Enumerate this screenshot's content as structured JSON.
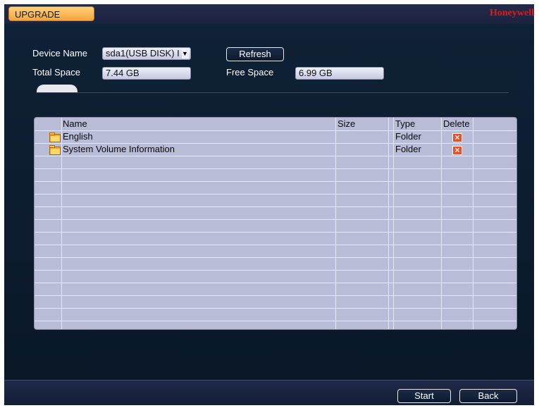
{
  "window": {
    "title": "UPGRADE",
    "brand": "Honeywell"
  },
  "device": {
    "name_label": "Device Name",
    "name_value": "sda1(USB DISK) I",
    "refresh_label": "Refresh",
    "total_label": "Total Space",
    "total_value": "7.44 GB",
    "free_label": "Free Space",
    "free_value": "6.99 GB"
  },
  "table": {
    "headers": [
      "Name",
      "Size",
      "Type",
      "Delete"
    ],
    "rows": [
      {
        "name": "English",
        "size": "",
        "type": "Folder",
        "icon": "folder-icon",
        "delete_icon": "delete-icon"
      },
      {
        "name": "System Volume Information",
        "size": "",
        "type": "Folder",
        "icon": "folder-icon",
        "delete_icon": "delete-icon"
      }
    ]
  },
  "footer": {
    "start_label": "Start",
    "back_label": "Back"
  },
  "colors": {
    "title_tab": "#f6a43a",
    "brand": "#e01a1a",
    "table_bg": "#b9bcd6",
    "delete_icon": "#e8502a"
  }
}
